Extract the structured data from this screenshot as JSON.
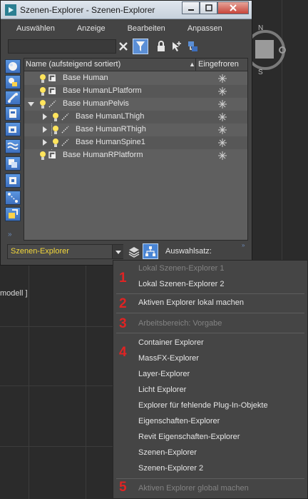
{
  "window": {
    "title": "Szenen-Explorer - Szenen-Explorer"
  },
  "menubar": {
    "items": [
      "Auswählen",
      "Anzeige",
      "Bearbeiten",
      "Anpassen"
    ]
  },
  "search": {
    "value": ""
  },
  "tree": {
    "headers": {
      "name": "Name (aufsteigend sortiert)",
      "frozen": "Eingefroren"
    },
    "rows": [
      {
        "label": "Base Human"
      },
      {
        "label": "Base HumanLPlatform"
      },
      {
        "label": "Base HumanPelvis"
      },
      {
        "label": "Base HumanLThigh"
      },
      {
        "label": "Base HumanRThigh"
      },
      {
        "label": "Base HumanSpine1"
      },
      {
        "label": "Base HumanRPlatform"
      }
    ]
  },
  "footer": {
    "explorer_select": "Szenen-Explorer",
    "selection_set_label": "Auswahlsatz:"
  },
  "viewport": {
    "label": "modell ]",
    "viewcube_letters": [
      "N",
      "S"
    ]
  },
  "context_menu": {
    "badges": [
      "1",
      "2",
      "3",
      "4",
      "5"
    ],
    "items": [
      {
        "label": "Lokal   Szenen-Explorer 1",
        "enabled": false
      },
      {
        "label": "Lokal   Szenen-Explorer 2",
        "enabled": true
      },
      {
        "label": "Aktiven Explorer lokal machen",
        "enabled": true
      },
      {
        "label": "Arbeitsbereich: Vorgabe",
        "enabled": false
      },
      {
        "label": "Container Explorer",
        "enabled": true
      },
      {
        "label": "MassFX-Explorer",
        "enabled": true
      },
      {
        "label": "Layer-Explorer",
        "enabled": true
      },
      {
        "label": "Licht Explorer",
        "enabled": true
      },
      {
        "label": "Explorer für fehlende Plug-In-Objekte",
        "enabled": true
      },
      {
        "label": "Eigenschaften-Explorer",
        "enabled": true
      },
      {
        "label": "Revit Eigenschaften-Explorer",
        "enabled": true
      },
      {
        "label": "Szenen-Explorer",
        "enabled": true
      },
      {
        "label": "Szenen-Explorer 2",
        "enabled": true
      },
      {
        "label": "Aktiven Explorer global machen",
        "enabled": false
      }
    ]
  },
  "colors": {
    "accent_blue": "#4a85d4",
    "badge_red": "#e02323",
    "dropdown_text": "#f3d73a",
    "menu_bg": "#454545",
    "disabled_text": "#838383"
  },
  "icons": {
    "side_buttons": [
      "sphere-icon",
      "geometry-icon",
      "bone-icon",
      "helper-icon",
      "camera-icon",
      "spacewarp-icon",
      "group-icon",
      "container-icon",
      "link-icon",
      "xref-icon"
    ]
  }
}
